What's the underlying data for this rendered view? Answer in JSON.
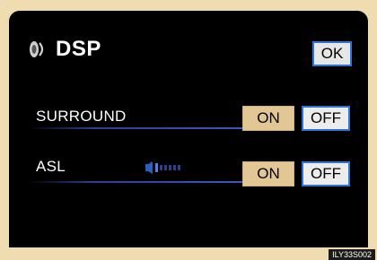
{
  "header": {
    "title": "DSP",
    "ok_label": "OK"
  },
  "rows": [
    {
      "label": "SURROUND",
      "on_label": "ON",
      "off_label": "OFF"
    },
    {
      "label": "ASL",
      "on_label": "ON",
      "off_label": "OFF"
    }
  ],
  "figure_code": "ILY33S002",
  "icons": {
    "title": "speaker-icon",
    "asl": "volume-level-icon"
  },
  "colors": {
    "screen": "#000000",
    "on_button": "#e2c795",
    "off_border": "#2b74d8",
    "frame": "#efdcb0"
  }
}
